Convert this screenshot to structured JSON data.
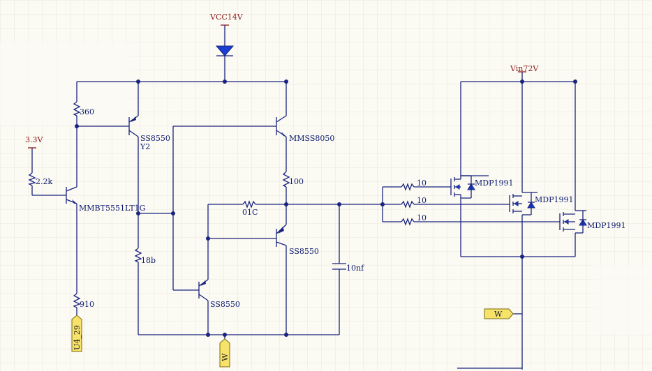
{
  "power": {
    "vcc": "VCC14V",
    "v33": "3.3V",
    "vin": "Vin72V"
  },
  "components": {
    "r_top": "360",
    "r_base": "2.2k",
    "r_bottom": "910",
    "r_mid": "18b",
    "r_collector": "100",
    "r_series": "01C",
    "cap": "10nf",
    "q_npn_main": "MMBT5551LT1G",
    "q_pnp_top": "SS8550",
    "q_pnp_top_ref": "Y2",
    "q_npn_top_right": "MMSS8050",
    "q_pnp_mid": "SS8550",
    "q_pnp_bottom": "SS8550",
    "gate_r1": "10",
    "gate_r2": "10",
    "gate_r3": "10",
    "mos1": "MDP1991",
    "mos2": "MDP1991",
    "mos3": "MDP1991"
  },
  "ports": {
    "u4": "U4_29",
    "w_bottom": "W",
    "w_right": "W"
  },
  "colors": {
    "wire": "#1a237e",
    "power_label": "#8b1a1a",
    "port_fill": "#f7e36a",
    "background": "#fbfaf3"
  }
}
